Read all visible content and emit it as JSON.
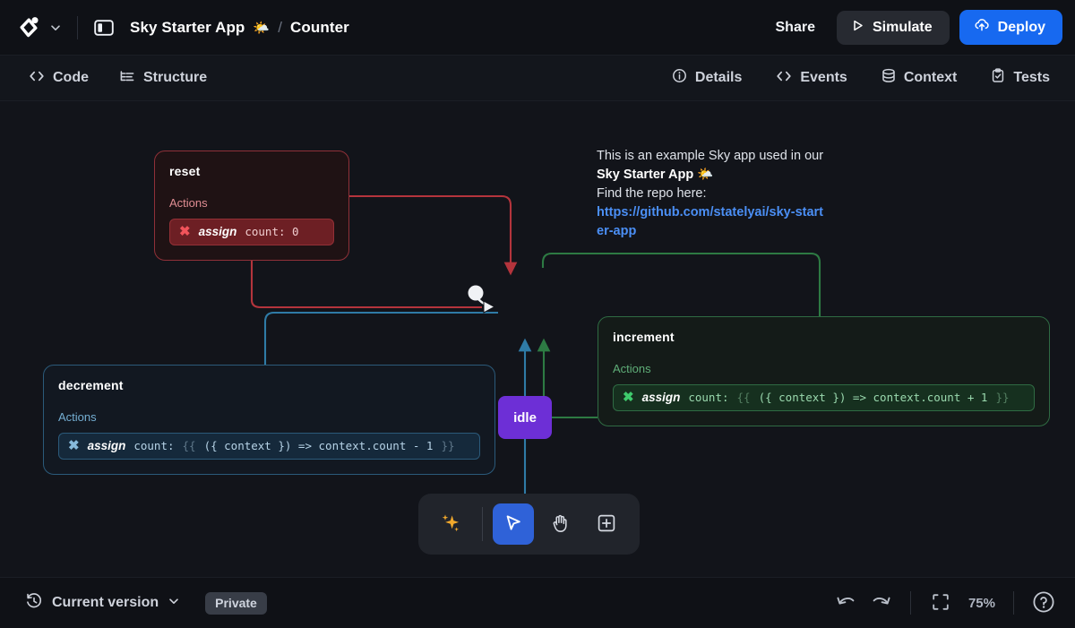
{
  "header": {
    "logo_icon": "stately-logo-icon",
    "logo_chevron_icon": "chevron-down-icon",
    "panel_toggle_icon": "sidebar-panel-icon",
    "breadcrumb": {
      "app_name": "Sky Starter App",
      "app_emoji": "🌤️",
      "separator": "/",
      "current": "Counter"
    },
    "share_label": "Share",
    "simulate_label": "Simulate",
    "simulate_icon": "play-icon",
    "deploy_label": "Deploy",
    "deploy_icon": "cloud-upload-icon",
    "deploy_color": "#1769f0"
  },
  "tabbar": {
    "left_tabs": [
      {
        "label": "Code",
        "icon": "code-brackets-icon"
      },
      {
        "label": "Structure",
        "icon": "tree-structure-icon"
      }
    ],
    "right_tabs": [
      {
        "label": "Details",
        "icon": "info-circle-icon"
      },
      {
        "label": "Events",
        "icon": "code-brackets-icon"
      },
      {
        "label": "Context",
        "icon": "database-icon"
      },
      {
        "label": "Tests",
        "icon": "clipboard-check-icon"
      }
    ]
  },
  "canvas": {
    "info": {
      "line1": "This is an example Sky app used in our",
      "line2_bold": "Sky Starter App",
      "line2_emoji": "🌤️",
      "line3": "Find the repo here:",
      "link": "https://github.com/statelyai/sky-starter-app"
    },
    "state_node": {
      "label": "idle",
      "color": "#6d2fd6"
    },
    "nodes": [
      {
        "id": "reset",
        "title": "reset",
        "actions_label": "Actions",
        "accent": "#f2545b",
        "action": {
          "icon": "assign-x-icon",
          "name": "assign",
          "expr": "count: 0"
        }
      },
      {
        "id": "increment",
        "title": "increment",
        "actions_label": "Actions",
        "accent": "#3fcb6d",
        "action": {
          "icon": "assign-x-icon",
          "name": "assign",
          "expr_key": "count: ",
          "expr_open": "{{",
          "expr_body": " ({ context }) => context.count + 1 ",
          "expr_close": "}}"
        }
      },
      {
        "id": "decrement",
        "title": "decrement",
        "actions_label": "Actions",
        "accent": "#86b9da",
        "action": {
          "icon": "assign-x-icon",
          "name": "assign",
          "expr_key": "count: ",
          "expr_open": "{{",
          "expr_body": " ({ context }) => context.count - 1 ",
          "expr_close": "}}"
        }
      }
    ],
    "toolbar": {
      "buttons": [
        {
          "name": "ai-assist-button",
          "icon": "sparkles-icon",
          "active": false
        },
        {
          "name": "select-tool-button",
          "icon": "cursor-arrow-icon",
          "active": true
        },
        {
          "name": "pan-tool-button",
          "icon": "hand-icon",
          "active": false
        },
        {
          "name": "add-node-button",
          "icon": "plus-square-icon",
          "active": false
        }
      ]
    }
  },
  "footer": {
    "history_icon": "history-revert-icon",
    "version_label": "Current version",
    "version_chevron_icon": "chevron-down-icon",
    "visibility_badge": "Private",
    "undo_icon": "undo-arrow-icon",
    "redo_icon": "redo-arrow-icon",
    "fit_icon": "fit-to-screen-icon",
    "zoom_level": "75%",
    "help_icon": "help-circle-icon"
  }
}
